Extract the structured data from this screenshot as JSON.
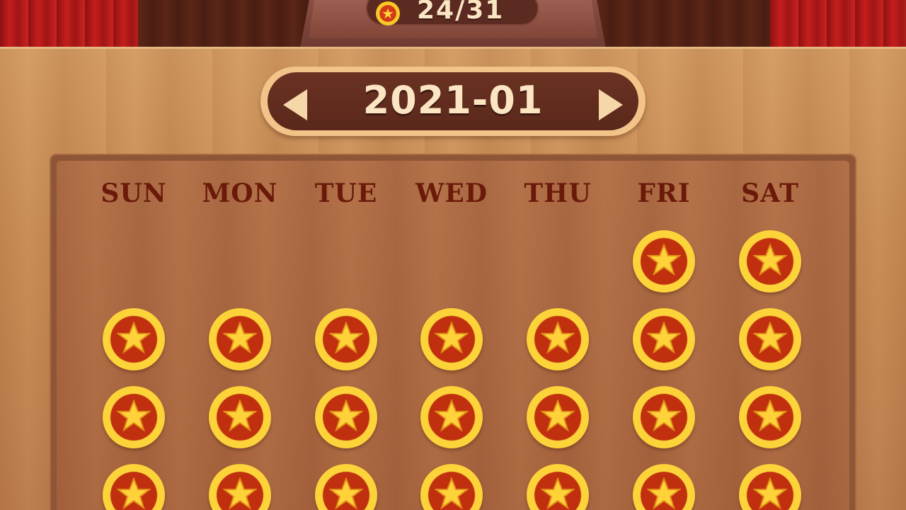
{
  "header": {
    "score_icon": "star-coin-icon",
    "score_text": "24/31"
  },
  "month_selector": {
    "label": "2021-01",
    "prev_icon": "left-arrow-icon",
    "next_icon": "right-arrow-icon"
  },
  "calendar": {
    "weekdays": [
      "SUN",
      "MON",
      "TUE",
      "WED",
      "THU",
      "FRI",
      "SAT"
    ],
    "day_icon": "star-coin-icon",
    "first_weekday_index": 5,
    "visible_rows": [
      [
        null,
        null,
        null,
        null,
        null,
        "completed",
        "completed"
      ],
      [
        "completed",
        "completed",
        "completed",
        "completed",
        "completed",
        "completed",
        "completed"
      ],
      [
        "completed",
        "completed",
        "completed",
        "completed",
        "completed",
        "completed",
        "completed"
      ],
      [
        "completed",
        "completed",
        "completed",
        "completed",
        "completed",
        "completed",
        "completed"
      ]
    ]
  },
  "colors": {
    "coin_red": "#c0300f",
    "coin_gold": "#fcd43a",
    "weekday_text": "#6b1a0a",
    "wood": "#c68a52"
  }
}
